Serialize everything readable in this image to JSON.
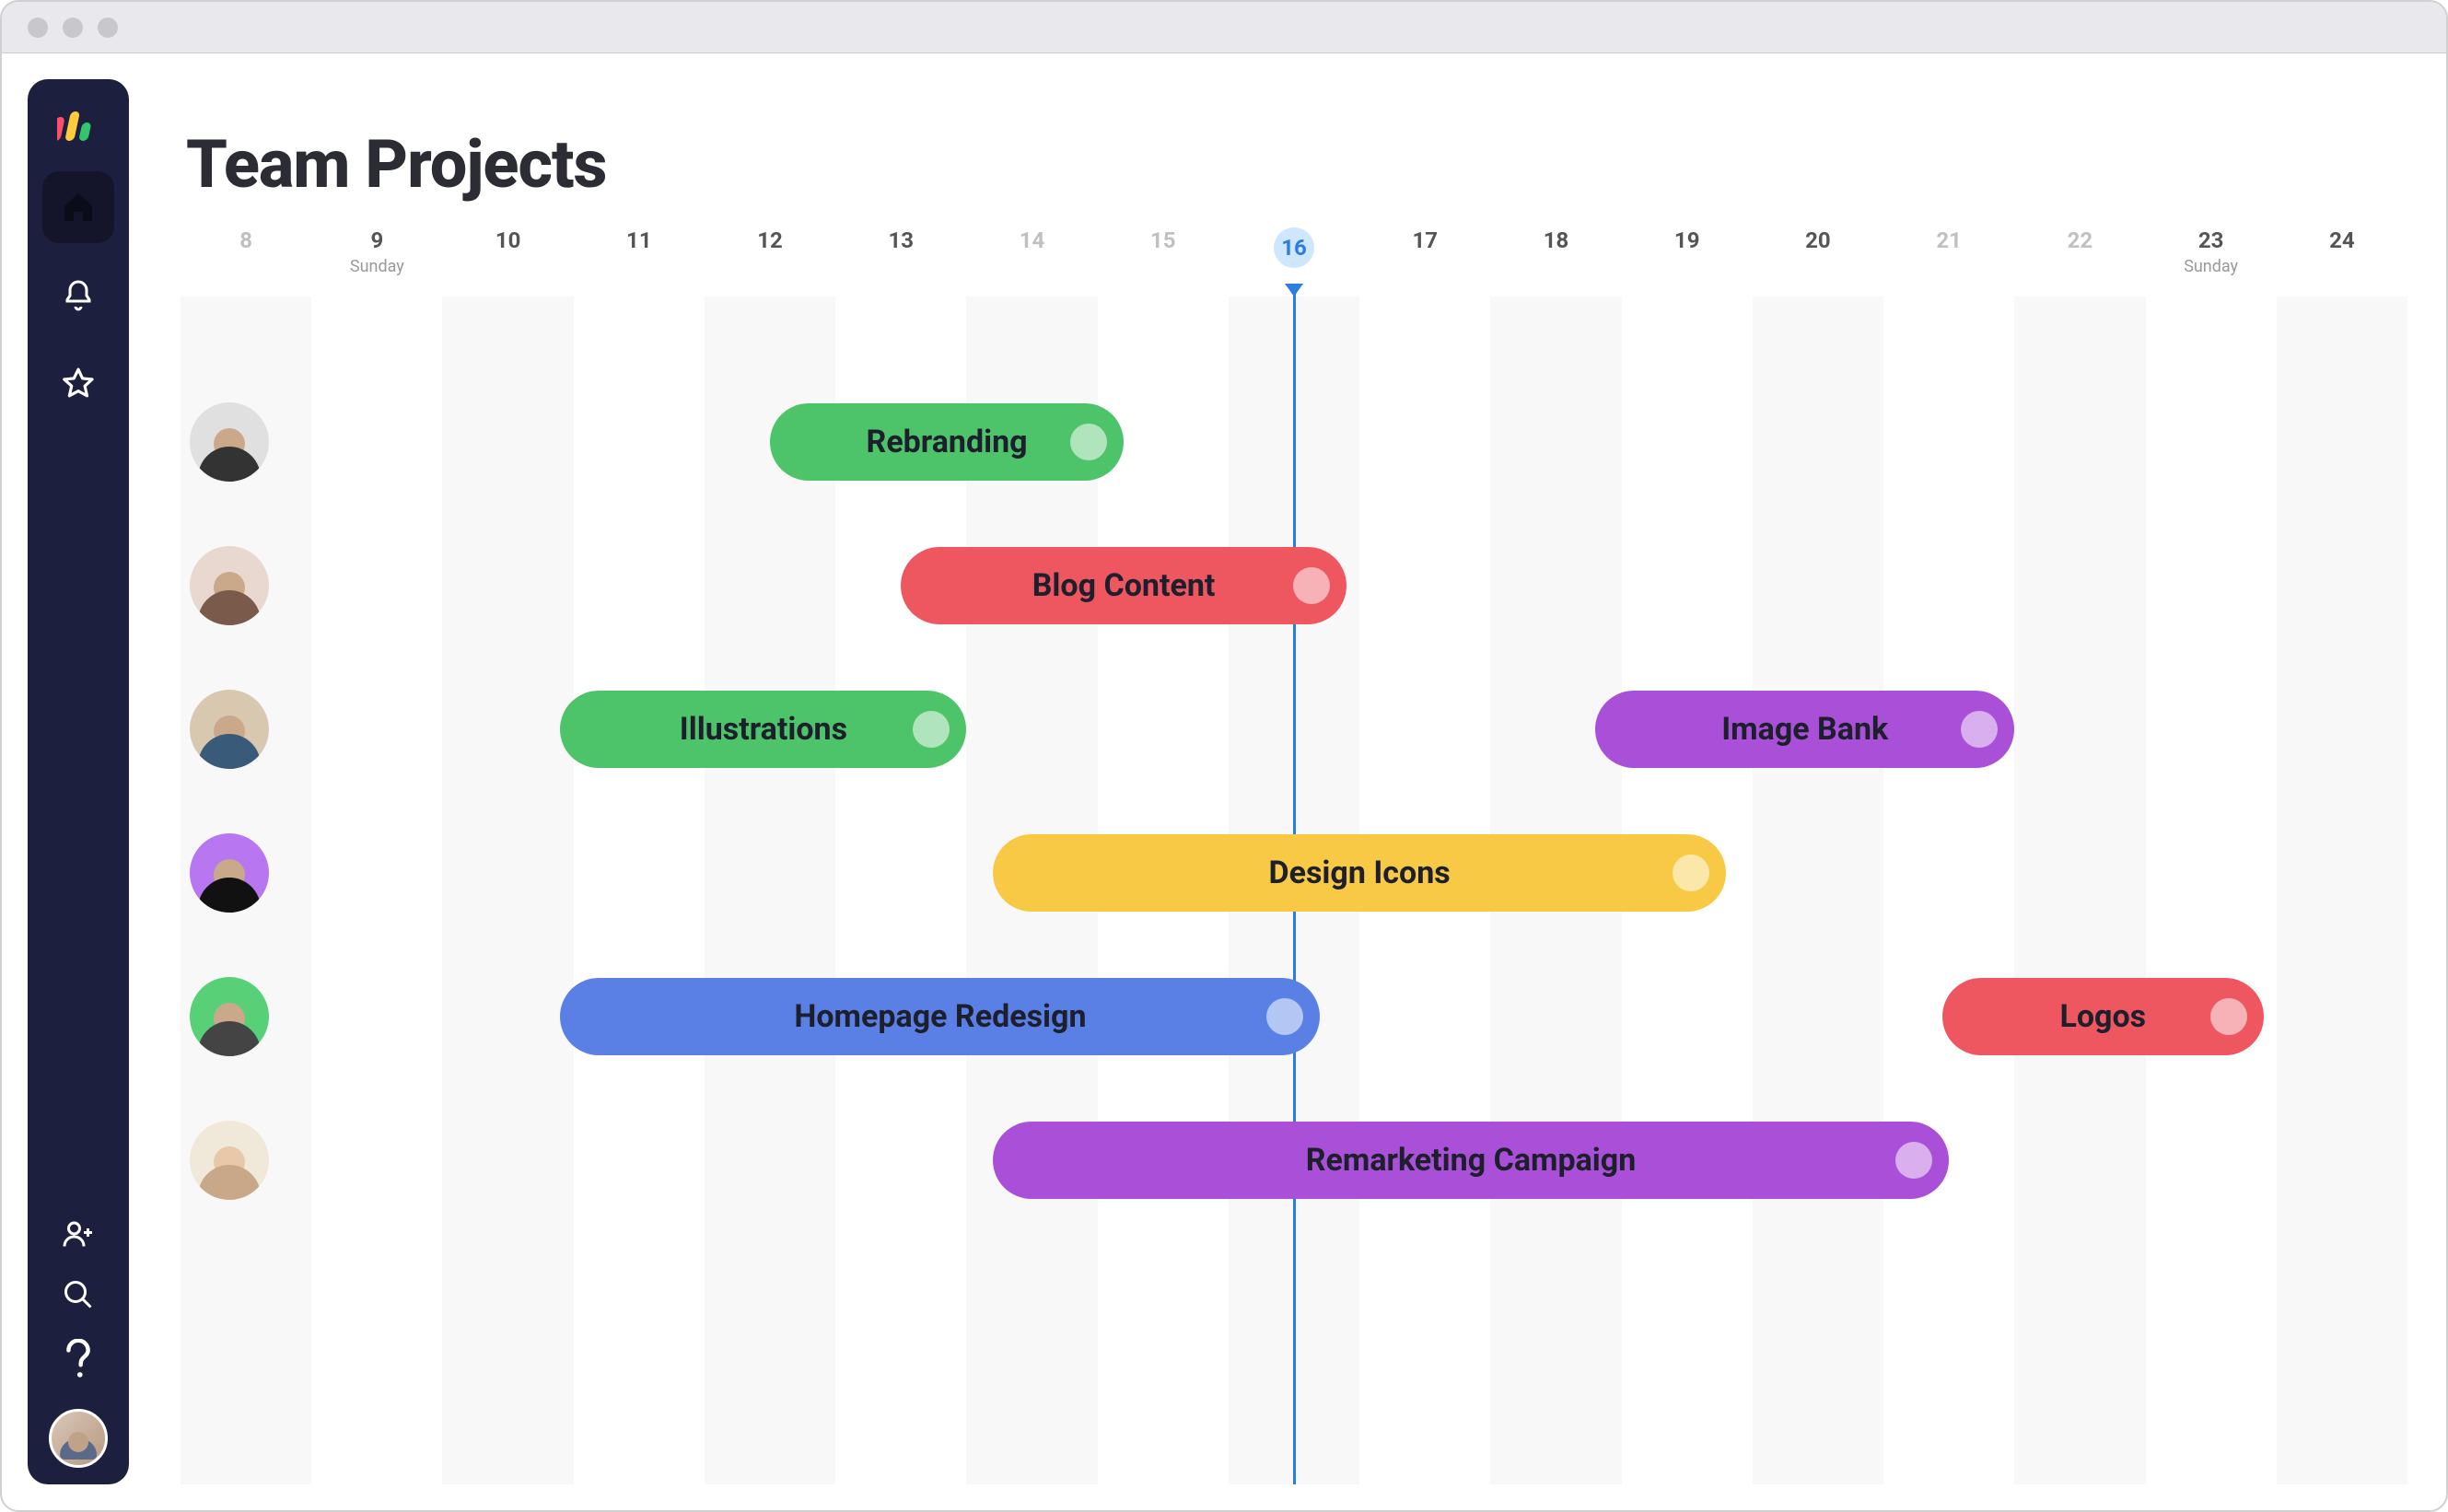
{
  "page": {
    "title": "Team Projects"
  },
  "sidebar": {
    "icons": [
      "home",
      "bell",
      "star",
      "invite",
      "search",
      "help"
    ]
  },
  "timeline": {
    "start_day": 8,
    "end_day": 24,
    "today": 16,
    "faded_days": [
      8,
      14,
      15,
      21,
      22
    ],
    "sundays": [
      9,
      23
    ]
  },
  "rows": [
    {
      "assignee": "member-1",
      "avatar_class": "ava-1",
      "tasks": [
        {
          "label": "Rebranding",
          "color": "green",
          "start": 12,
          "end": 14.7
        }
      ]
    },
    {
      "assignee": "member-2",
      "avatar_class": "ava-2",
      "tasks": [
        {
          "label": "Blog Content",
          "color": "red",
          "start": 13,
          "end": 16.4
        }
      ]
    },
    {
      "assignee": "member-3",
      "avatar_class": "ava-3",
      "tasks": [
        {
          "label": "Illustrations",
          "color": "green",
          "start": 10.4,
          "end": 13.5
        },
        {
          "label": "Image Bank",
          "color": "purple",
          "start": 18.3,
          "end": 21.5
        }
      ]
    },
    {
      "assignee": "member-4",
      "avatar_class": "ava-4",
      "tasks": [
        {
          "label": "Design Icons",
          "color": "yellow",
          "start": 13.7,
          "end": 19.3
        }
      ]
    },
    {
      "assignee": "member-5",
      "avatar_class": "ava-5",
      "tasks": [
        {
          "label": "Homepage Redesign",
          "color": "blue",
          "start": 10.4,
          "end": 16.2
        },
        {
          "label": "Logos",
          "color": "red",
          "start": 20.95,
          "end": 23.4
        }
      ]
    },
    {
      "assignee": "member-6",
      "avatar_class": "ava-6",
      "tasks": [
        {
          "label": "Remarketing Campaign",
          "color": "purple",
          "start": 13.7,
          "end": 21.0
        }
      ]
    }
  ],
  "chart_data": {
    "type": "gantt",
    "title": "Team Projects",
    "x_axis": {
      "unit": "day",
      "domain": [
        8,
        24
      ],
      "today_marker": 16,
      "sundays": [
        9,
        23
      ]
    },
    "series": [
      {
        "assignee": "member-1",
        "task": "Rebranding",
        "start": 12.0,
        "end": 14.7,
        "color": "#4ec46a"
      },
      {
        "assignee": "member-2",
        "task": "Blog Content",
        "start": 13.0,
        "end": 16.4,
        "color": "#ee5660"
      },
      {
        "assignee": "member-3",
        "task": "Illustrations",
        "start": 10.4,
        "end": 13.5,
        "color": "#4ec46a"
      },
      {
        "assignee": "member-3",
        "task": "Image Bank",
        "start": 18.3,
        "end": 21.5,
        "color": "#AA4FD8"
      },
      {
        "assignee": "member-4",
        "task": "Design Icons",
        "start": 13.7,
        "end": 19.3,
        "color": "#f7c944"
      },
      {
        "assignee": "member-5",
        "task": "Homepage Redesign",
        "start": 10.4,
        "end": 16.2,
        "color": "#5a80e6"
      },
      {
        "assignee": "member-5",
        "task": "Logos",
        "start": 20.95,
        "end": 23.4,
        "color": "#ee5660"
      },
      {
        "assignee": "member-6",
        "task": "Remarketing Campaign",
        "start": 13.7,
        "end": 21.0,
        "color": "#AA4FD8"
      }
    ]
  },
  "labels": {
    "sunday": "Sunday"
  }
}
